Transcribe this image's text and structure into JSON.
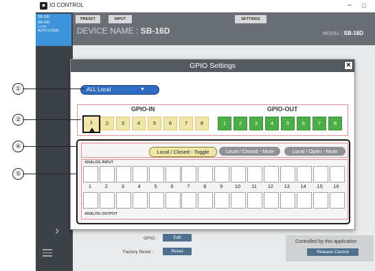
{
  "window": {
    "title": "IO CONTROL",
    "app_icon": "app-logo-icon",
    "minimize": "–",
    "maximize": "□"
  },
  "sidebar": {
    "device_lines": [
      "SB-16D",
      "SB-16D",
      "LOGIN",
      "AUTO LOGIN"
    ],
    "expand_icon": "chevron-right-icon",
    "menu_icon": "hamburger-menu-icon"
  },
  "toolbar": {
    "tabs": [
      "PRESET",
      "INPUT",
      "SETTINGS"
    ],
    "device_name_label": "DEVICE NAME :",
    "device_name": "SB-16D",
    "model_label": "MODEL :",
    "model": "SB-16D"
  },
  "background": {
    "gpio_label": "GPIO :",
    "gpio_edit": "Edit",
    "factory_label": "Factory Reset :",
    "factory_reset": "Reset",
    "controlled_text": "Controlled by this application",
    "release_control": "Release Control"
  },
  "modal": {
    "title": "GPIO Settings",
    "close": "×",
    "mode_select": {
      "value": "ALL Local",
      "caret": "▼"
    },
    "gpio_in_label": "GPIO-IN",
    "gpio_out_label": "GPIO-OUT",
    "gpio_in": [
      "1",
      "2",
      "3",
      "4",
      "5",
      "6",
      "7",
      "8"
    ],
    "gpio_out": [
      "1",
      "2",
      "3",
      "4",
      "5",
      "6",
      "7",
      "8"
    ],
    "selected_gpio_in": "1",
    "modes": [
      "Local / Closed - Toggle",
      "Local / Closed - Mute",
      "Local / Open - Mute"
    ],
    "active_mode": "Local / Closed - Toggle",
    "analog_input_label": "ANALOG INPUT",
    "analog_output_label": "ANALOG OUTPUT",
    "channels": [
      "1",
      "2",
      "3",
      "4",
      "5",
      "6",
      "7",
      "8",
      "9",
      "10",
      "11",
      "12",
      "13",
      "14",
      "15",
      "16"
    ]
  },
  "callouts": [
    "①",
    "②",
    "④",
    "⑤"
  ],
  "colors": {
    "sidebar": "#3d4248",
    "device_list": "#3c93d9",
    "mode_select": "#2f6cc2",
    "gpio_in": "#f0e6a8",
    "gpio_out": "#4dae47",
    "annotation_box": "#e88d8d"
  }
}
